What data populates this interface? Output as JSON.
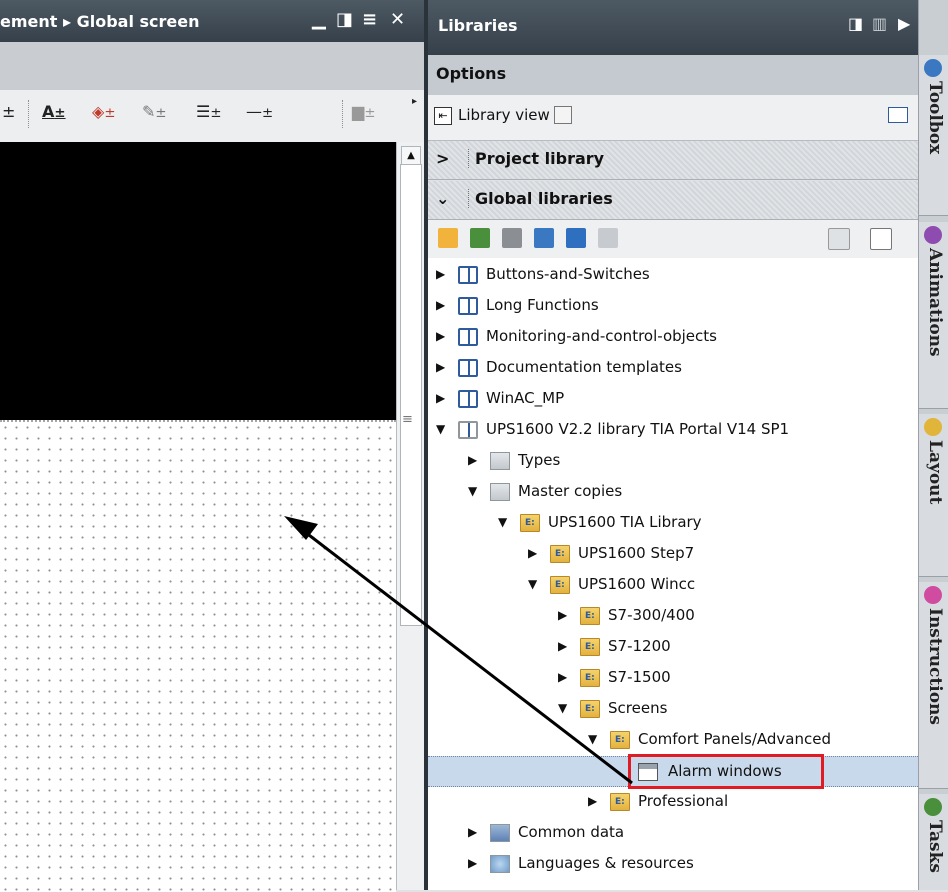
{
  "editor": {
    "title": "ement ▸ Global screen",
    "window_buttons": [
      "▁",
      "◨",
      "≡",
      "✕"
    ]
  },
  "libraries": {
    "title": "Libraries",
    "options_label": "Options",
    "library_view_label": "Library view",
    "sections": {
      "project": "Project library",
      "global": "Global libraries"
    },
    "tree": [
      {
        "label": "Buttons-and-Switches"
      },
      {
        "label": "Long Functions"
      },
      {
        "label": "Monitoring-and-control-objects"
      },
      {
        "label": "Documentation templates"
      },
      {
        "label": "WinAC_MP"
      },
      {
        "label": "UPS1600 V2.2 library TIA Portal V14 SP1"
      },
      {
        "label": "Types"
      },
      {
        "label": "Master copies"
      },
      {
        "label": "UPS1600 TIA Library"
      },
      {
        "label": "UPS1600 Step7"
      },
      {
        "label": "UPS1600 Wincc"
      },
      {
        "label": "S7-300/400"
      },
      {
        "label": "S7-1200"
      },
      {
        "label": "S7-1500"
      },
      {
        "label": "Screens"
      },
      {
        "label": "Comfort Panels/Advanced"
      },
      {
        "label": "Alarm windows"
      },
      {
        "label": "Professional"
      },
      {
        "label": "Common data"
      },
      {
        "label": "Languages & resources"
      }
    ]
  },
  "task_tabs": [
    "Toolbox",
    "Animations",
    "Layout",
    "Instructions",
    "Tasks"
  ],
  "colors": {
    "title_bar": "#3f4a54",
    "highlight": "#e01b24",
    "selection": "#c9d9ec"
  }
}
